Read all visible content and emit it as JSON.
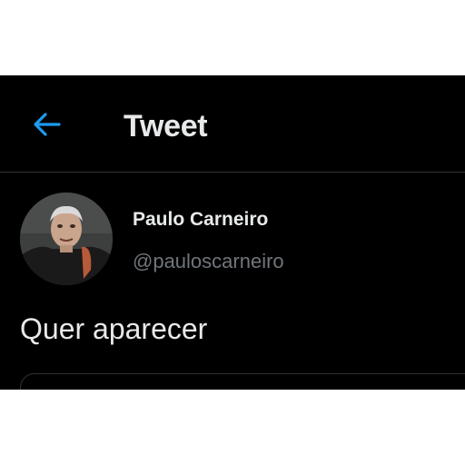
{
  "header": {
    "back_icon": "arrow-left-icon",
    "title": "Tweet"
  },
  "tweet": {
    "author_name": "Paulo Carneiro",
    "author_handle": "@pauloscarneiro",
    "text": "Quer aparecer"
  },
  "colors": {
    "background": "#000000",
    "accent": "#1d9bf0",
    "primary_text": "#e7e9ea",
    "secondary_text": "#71767b",
    "divider": "#2f3336"
  }
}
